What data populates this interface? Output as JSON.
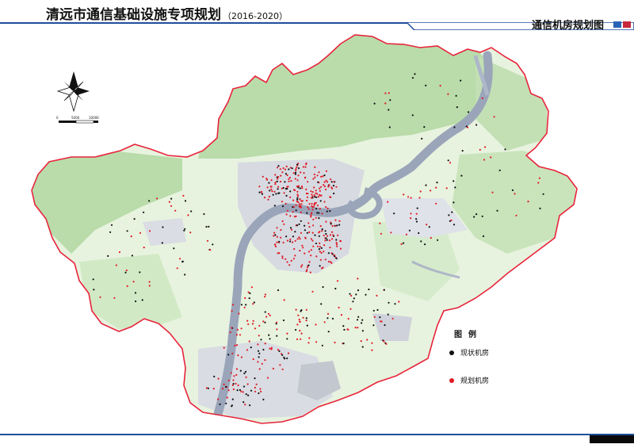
{
  "header": {
    "title": "清远市通信基础设施专项规划",
    "years": "（2016-2020）",
    "subtitle": "通信机房规划图"
  },
  "colors": {
    "boundary": "#e8243b",
    "river": "#9aa5ba",
    "green_light": "#e7f3df",
    "green_mid": "#c9e4bb",
    "green_dark": "#a9d49c",
    "urban": "#d4d7de",
    "existing_room": "#111111",
    "planned_room": "#e11a24",
    "header_blue": "#1f4f9e"
  },
  "legend": {
    "title": "图例",
    "items": [
      {
        "label": "现状机房",
        "color": "#111111"
      },
      {
        "label": "规划机房",
        "color": "#e11a24"
      }
    ]
  },
  "scalebar": {
    "labels": [
      "0",
      "5000",
      "10000"
    ]
  },
  "icons": {
    "compass": "north-arrow-icon"
  }
}
